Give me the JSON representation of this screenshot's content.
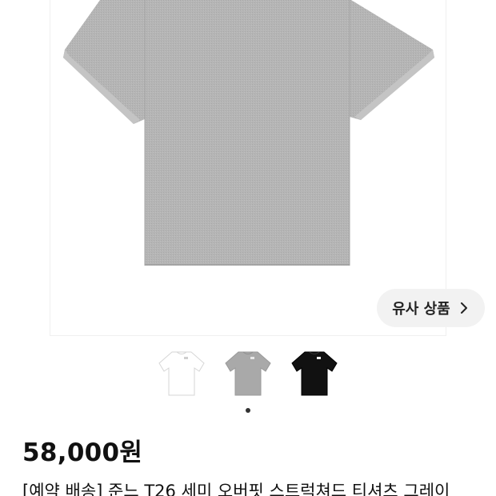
{
  "product": {
    "main_image_icon": "gray-tshirt-illustration",
    "thumbnails": [
      {
        "color_name": "white",
        "color": "#ffffff",
        "icon": "white-tshirt-thumbnail"
      },
      {
        "color_name": "gray",
        "color": "#a9a9a9",
        "icon": "gray-tshirt-thumbnail"
      },
      {
        "color_name": "black",
        "color": "#111111",
        "icon": "black-tshirt-thumbnail"
      }
    ],
    "similar_button_label": "유사 상품",
    "price": "58,000원",
    "title": "[예약 배송] 준느 T26 세미 오버핏 스트럭쳐드 티셔츠 그레이"
  },
  "colors": {
    "tshirt_gray": "#b3b3b3",
    "button_bg": "#f2f2f2",
    "dot": "#333333"
  }
}
